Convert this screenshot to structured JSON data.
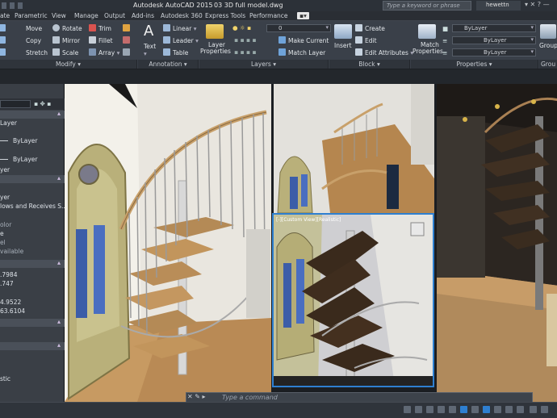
{
  "window": {
    "app_title": "Autodesk AutoCAD 2015",
    "file_title": "03 3D full model.dwg"
  },
  "search": {
    "placeholder": "Type a keyword or phrase"
  },
  "user": {
    "name": "hewettn"
  },
  "menu_tabs": [
    "ate",
    "Parametric",
    "View",
    "Manage",
    "Output",
    "Add-ins",
    "Autodesk 360",
    "Express Tools",
    "Performance"
  ],
  "ribbon": {
    "modify": {
      "move": "Move",
      "rotate": "Rotate",
      "trim": "Trim",
      "copy": "Copy",
      "mirror": "Mirror",
      "fillet": "Fillet",
      "stretch": "Stretch",
      "scale": "Scale",
      "array": "Array",
      "label": "Modify"
    },
    "annotation": {
      "text": "Text",
      "linear": "Linear",
      "leader": "Leader",
      "table": "Table",
      "label": "Annotation"
    },
    "layers": {
      "layer_properties_1": "Layer",
      "layer_properties_2": "Properties",
      "layer_combo": "0",
      "make_current": "Make Current",
      "match_layer": "Match Layer",
      "label": "Layers"
    },
    "block": {
      "insert": "Insert",
      "create": "Create",
      "edit": "Edit",
      "edit_attributes": "Edit Attributes",
      "label": "Block"
    },
    "properties": {
      "match_1": "Match",
      "match_2": "Properties",
      "color": "ByLayer",
      "linetype": "ByLayer",
      "lineweight": "ByLayer",
      "label": "Properties"
    },
    "groups": {
      "group": "Group",
      "label": "Grou"
    }
  },
  "palette": {
    "rows": [
      "Layer",
      "ByLayer",
      "ByLayer",
      "yer",
      "yer",
      "lows and Receives S...",
      "olor",
      "e",
      "el",
      "vailable",
      ".7984",
      ".747",
      "4.9522",
      "63.6104",
      "stic"
    ]
  },
  "viewport_br": {
    "label": "[-][Custom View][Realistic]"
  },
  "command": {
    "placeholder": "Type a command"
  },
  "colors": {
    "accent": "#2e7fd0",
    "ribbon_bg": "#3a4049",
    "palette_bg": "#3a3f46"
  }
}
